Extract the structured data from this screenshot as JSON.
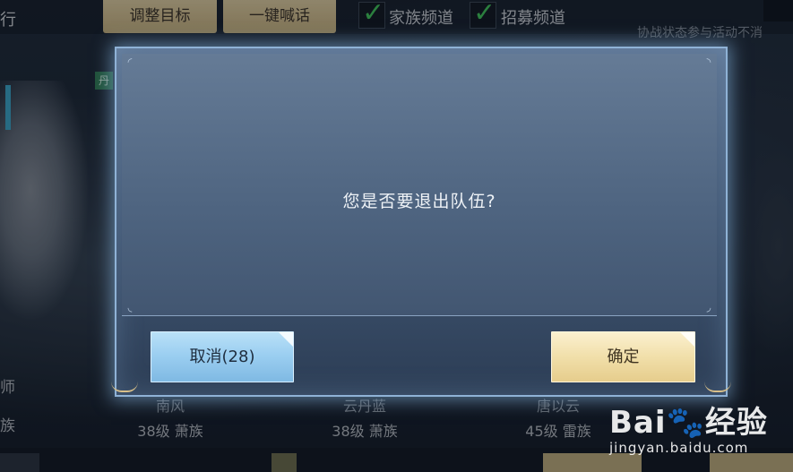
{
  "topbar": {
    "left_text": "行",
    "adjust_target_button": "调整目标",
    "shout_button": "一键喊话",
    "family_channel_label": "家族频道",
    "recruit_channel_label": "招募频道",
    "right_note": "协战状态参与活动不消"
  },
  "background": {
    "left_edge_text_1": "师",
    "left_edge_text_2": "族",
    "members": [
      {
        "name": "南风",
        "info": "38级  萧族"
      },
      {
        "name": "云丹蓝",
        "info": "38级  萧族"
      },
      {
        "name": "唐以云",
        "info": "45级  雷族"
      }
    ]
  },
  "dialog": {
    "message": "您是否要退出队伍?",
    "cancel_label": "取消(28)",
    "confirm_label": "确定"
  },
  "watermark": {
    "logo": "Bai🐾经验",
    "url": "jingyan.baidu.com"
  },
  "colors": {
    "dialog_border": "#8fb2d6",
    "cancel_button": "#9ccff1",
    "confirm_button": "#f1dfaa",
    "check_green": "#3fbf56",
    "gold_button": "#c9b585"
  }
}
